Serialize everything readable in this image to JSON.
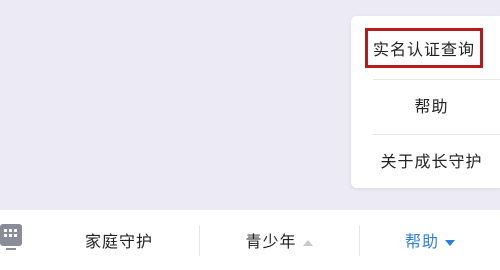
{
  "popup_menu": {
    "items": [
      {
        "label": "实名认证查询",
        "highlighted": true
      },
      {
        "label": "帮助"
      },
      {
        "label": "关于成长守护"
      }
    ]
  },
  "bottom_nav": {
    "menu_icon": "keyboard-grid-icon",
    "items": [
      {
        "label": "家庭守护"
      },
      {
        "label": "青少年",
        "caret": "up",
        "caret_color": "#c8c8cc"
      },
      {
        "label": "帮助",
        "caret": "down",
        "active": true,
        "caret_color": "#2b7fe0"
      }
    ]
  },
  "colors": {
    "background": "#ecebf5",
    "accent": "#2b7fe0",
    "highlight_border": "#b71c1c"
  }
}
